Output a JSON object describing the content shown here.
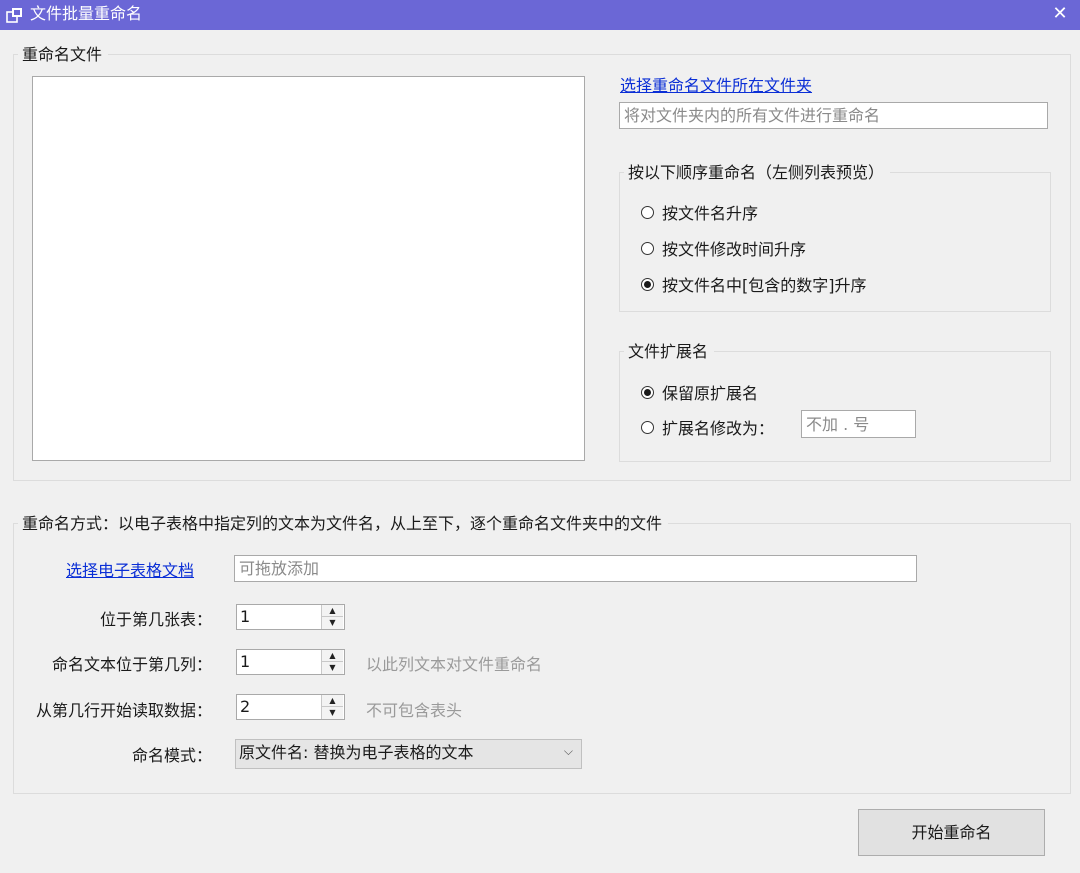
{
  "window": {
    "title": "文件批量重命名",
    "close_glyph": "✕",
    "title_bar_color": "#6b67d6"
  },
  "files_group": {
    "legend": "重命名文件",
    "select_folder_link": "选择重命名文件所在文件夹",
    "folder_input_placeholder": "将对文件夹内的所有文件进行重命名",
    "order_group": {
      "legend": "按以下顺序重命名（左侧列表预览）",
      "options": [
        {
          "label": "按文件名升序",
          "checked": false
        },
        {
          "label": "按文件修改时间升序",
          "checked": false
        },
        {
          "label": "按文件名中[包含的数字]升序",
          "checked": true
        }
      ]
    },
    "extension_group": {
      "legend": "文件扩展名",
      "keep_label": "保留原扩展名",
      "keep_checked": true,
      "change_label": "扩展名修改为：",
      "change_checked": false,
      "ext_placeholder": "不加 . 号"
    }
  },
  "method_group": {
    "legend": "重命名方式：以电子表格中指定列的文本为文件名，从上至下，逐个重命名文件夹中的文件",
    "select_sheet_link": "选择电子表格文档",
    "sheet_input_placeholder": "可拖放添加",
    "sheet_index_label": "位于第几张表：",
    "sheet_index_value": "1",
    "column_label": "命名文本位于第几列：",
    "column_value": "1",
    "column_hint": "以此列文本对文件重命名",
    "start_row_label": "从第几行开始读取数据：",
    "start_row_value": "2",
    "start_row_hint": "不可包含表头",
    "mode_label": "命名模式：",
    "mode_value": "原文件名: 替换为电子表格的文本"
  },
  "start_button": "开始重命名"
}
